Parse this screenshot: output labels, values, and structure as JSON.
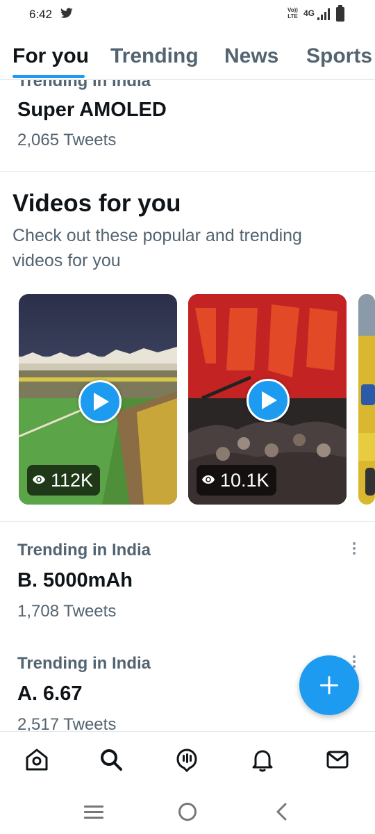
{
  "status_bar": {
    "time": "6:42",
    "volte_line1": "Vo))",
    "volte_line2": "LTE",
    "network": "4G"
  },
  "tabs": [
    {
      "label": "For you",
      "active": true
    },
    {
      "label": "Trending"
    },
    {
      "label": "News"
    },
    {
      "label": "Sports"
    }
  ],
  "trends_top": {
    "context": "Trending in India",
    "name": "Super AMOLED",
    "count": "2,065 Tweets"
  },
  "videos": {
    "title": "Videos for you",
    "subtitle": "Check out these popular and trending videos for you",
    "items": [
      {
        "views": "112K"
      },
      {
        "views": "10.1K"
      }
    ]
  },
  "trends": [
    {
      "context": "Trending in India",
      "name": "B. 5000mAh",
      "count": "1,708 Tweets"
    },
    {
      "context": "Trending in India",
      "name": "A. 6.67",
      "count": "2,517 Tweets"
    }
  ],
  "colors": {
    "accent": "#1d9bf0",
    "text_primary": "#0f1419",
    "text_secondary": "#536471"
  },
  "icons": {
    "bottom_nav": [
      "home-icon",
      "search-icon",
      "spaces-icon",
      "notifications-icon",
      "messages-icon"
    ],
    "system_nav": [
      "recents-icon",
      "home-circle-icon",
      "back-icon"
    ]
  }
}
